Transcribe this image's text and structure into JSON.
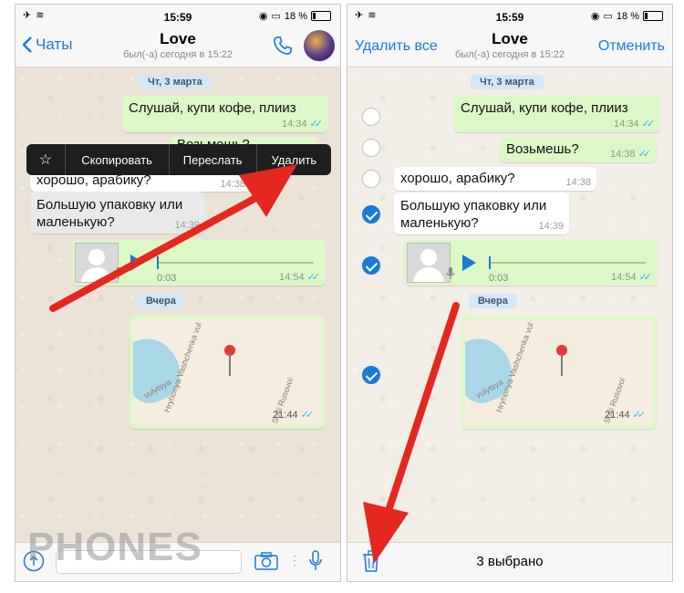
{
  "colors": {
    "accent": "#1b7ad6",
    "outgoing_bubble": "#dcf8c6",
    "arrow": "#e5281f",
    "checkmark": "#34b7f1"
  },
  "status_bar": {
    "time": "15:59",
    "battery": "18 %"
  },
  "left_screen": {
    "nav": {
      "back_label": "Чаты",
      "title": "Love",
      "subtitle": "был(-а) сегодня в 15:22"
    },
    "date_today": "Чт, 3 марта",
    "date_yesterday": "Вчера",
    "messages": [
      {
        "text": "Слушай, купи кофе, плииз",
        "time": "14:34"
      },
      {
        "text": "Возьмешь?",
        "time": "14:38"
      },
      {
        "text": "хорошо, арабику?",
        "time": "14:38"
      },
      {
        "text": "Большую упаковку или маленькую?",
        "time": "14:39"
      }
    ],
    "voice": {
      "duration": "0:03",
      "time": "14:54"
    },
    "location": {
      "time": "21:44",
      "street1": "Hryhoriya Vashchenka vul",
      "street2": "Sofii Rusovoi",
      "street3": "vulytsya"
    },
    "context_menu": {
      "star": "☆",
      "copy": "Скопировать",
      "forward": "Переслать",
      "delete": "Удалить"
    }
  },
  "right_screen": {
    "nav": {
      "left_action": "Удалить все",
      "title": "Love",
      "subtitle": "был(-а) сегодня в 15:22",
      "right_action": "Отменить"
    },
    "date_today": "Чт, 3 марта",
    "date_yesterday": "Вчера",
    "messages": [
      {
        "text": "Слушай, купи кофе, плииз",
        "time": "14:34"
      },
      {
        "text": "Возьмешь?",
        "time": "14:38"
      },
      {
        "text": "хорошо, арабику?",
        "time": "14:38"
      },
      {
        "text": "Большую упаковку или маленькую?",
        "time": "14:39"
      }
    ],
    "voice": {
      "duration": "0:03",
      "time": "14:54"
    },
    "location": {
      "time": "21:44",
      "street1": "Hryhoriya Vashchenka vul",
      "street2": "Sofii Rusovoi",
      "street3": "vulytsya"
    },
    "selected_count": "3 выбрано"
  },
  "watermark": "PHONES",
  "icons": [
    "airplane-icon",
    "wifi-icon",
    "alarm-icon",
    "screen-icon",
    "battery-icon",
    "back-chevron-icon",
    "phone-icon",
    "play-icon",
    "mic-icon",
    "camera-icon",
    "upload-icon",
    "trash-icon",
    "star-icon",
    "check-icon"
  ]
}
